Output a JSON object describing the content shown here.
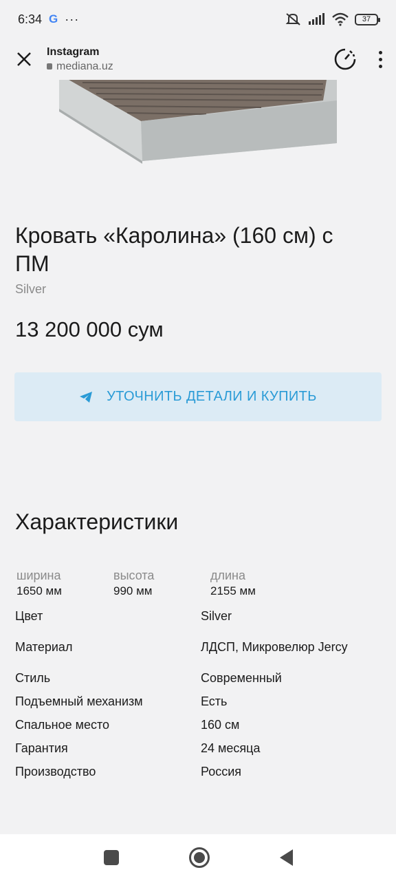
{
  "status_bar": {
    "time": "6:34",
    "google_label": "G",
    "more_label": "···",
    "battery": "37"
  },
  "browser": {
    "title": "Instagram",
    "host": "mediana.uz"
  },
  "product": {
    "title": "Кровать «Каролина» (160 см) с ПМ",
    "subtitle": "Silver",
    "price": "13 200 000 сум",
    "buy_label": "УТОЧНИТЬ ДЕТАЛИ И КУПИТЬ"
  },
  "specs": {
    "title": "Характеристики",
    "dimensions": [
      {
        "label": "ширина",
        "value": "1650 мм"
      },
      {
        "label": "высота",
        "value": "990 мм"
      },
      {
        "label": "длина",
        "value": "2155 мм"
      }
    ],
    "rows": [
      {
        "key": "Цвет",
        "value": "Silver"
      },
      {
        "key": "Материал",
        "value": "ЛДСП, Микровелюр Jercy"
      },
      {
        "key": "Стиль",
        "value": "Современный"
      },
      {
        "key": "Подъемный механизм",
        "value": "Есть"
      },
      {
        "key": "Спальное место",
        "value": "160 см"
      },
      {
        "key": "Гарантия",
        "value": "24 месяца"
      },
      {
        "key": "Производство",
        "value": "Россия"
      }
    ]
  },
  "colors": {
    "background": "#f2f2f3",
    "accent": "#2a9bd6",
    "button_bg": "#dcebf5",
    "muted_text": "#8a8a8a"
  },
  "icons": [
    "close-icon",
    "lock-icon",
    "speed-dial-icon",
    "more-vert-icon",
    "telegram-icon",
    "nav-recents-icon",
    "nav-home-icon",
    "nav-back-icon"
  ]
}
